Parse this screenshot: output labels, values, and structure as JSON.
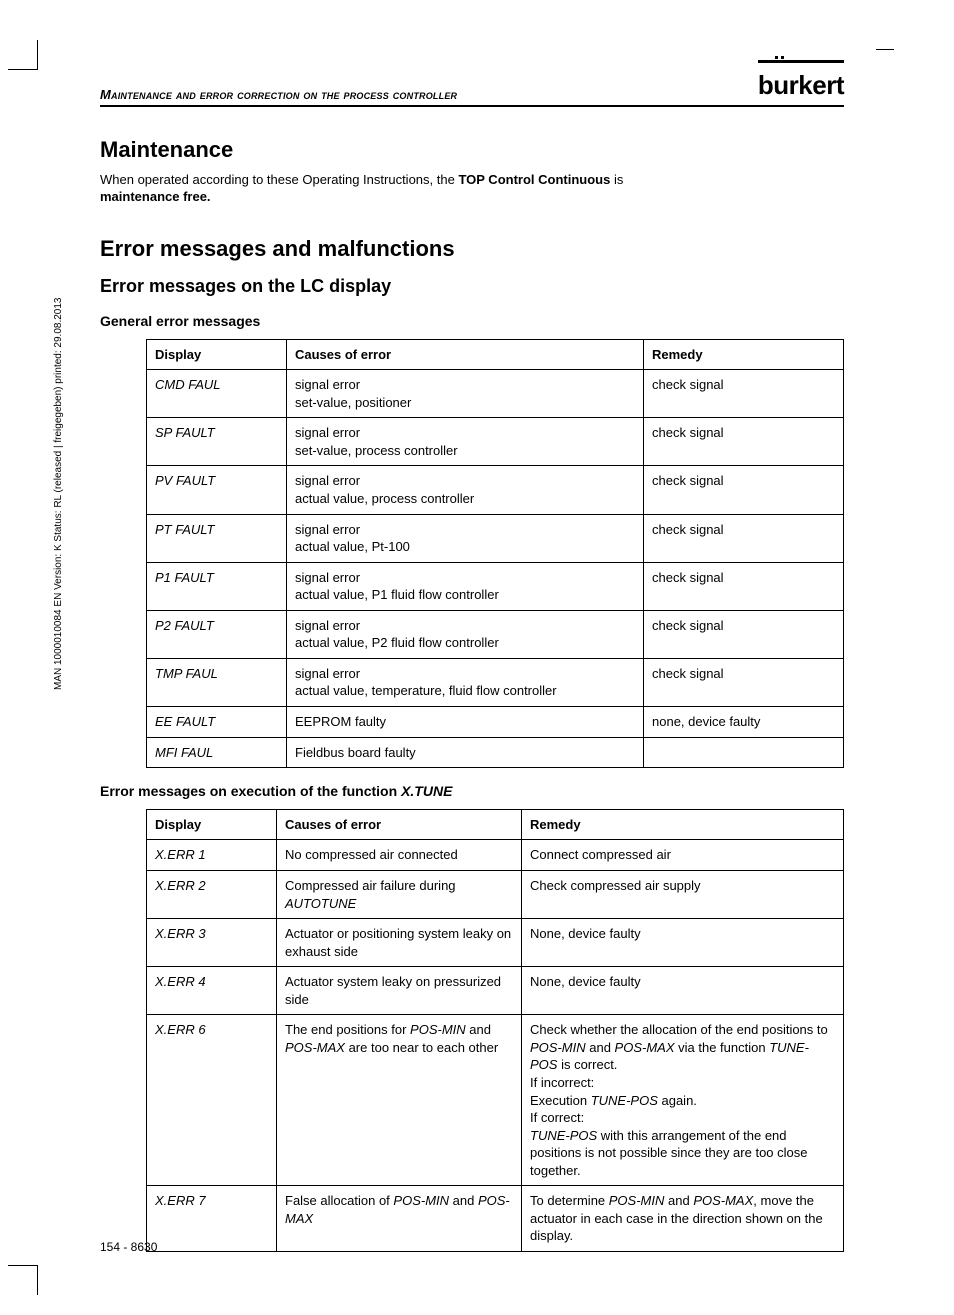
{
  "header": {
    "running": "Maintenance and error correction on the process controller",
    "logo": "burkert"
  },
  "side_text": "MAN 1000010084 EN Version: K Status: RL (released | freigegeben) printed: 29.08.2013",
  "maintenance": {
    "title": "Maintenance",
    "para_a": "When operated according to these Operating Instructions, the ",
    "para_b_bold": "TOP Control Continuous",
    "para_c": " is ",
    "para_d_bold": "maintenance free."
  },
  "errors": {
    "title": "Error messages and malfunctions",
    "sub1": "Error messages on  the LC display",
    "general_title": "General error messages",
    "th_display": "Display",
    "th_cause": "Causes of error",
    "th_remedy": "Remedy",
    "general_rows": [
      {
        "d": "CMD FAUL",
        "c1": "signal error",
        "c2": "set-value, positioner",
        "r": "check signal"
      },
      {
        "d": "SP  FAULT",
        "c1": "signal error",
        "c2": "set-value, process controller",
        "r": "check signal"
      },
      {
        "d": "PV FAULT",
        "c1": "signal error",
        "c2": "actual value, process controller",
        "r": "check signal"
      },
      {
        "d": "PT FAULT",
        "c1": "signal error",
        "c2": "actual value, Pt-100",
        "r": "check signal"
      },
      {
        "d": "P1 FAULT",
        "c1": "signal error",
        "c2": "actual value, P1 fluid flow controller",
        "r": "check signal"
      },
      {
        "d": "P2 FAULT",
        "c1": "signal error",
        "c2": "actual value, P2 fluid flow controller",
        "r": "check signal"
      },
      {
        "d": "TMP FAUL",
        "c1": "signal error",
        "c2": "actual value, temperature, fluid flow controller",
        "r": "check signal"
      },
      {
        "d": "EE FAULT",
        "c1": "EEPROM faulty",
        "c2": "",
        "r": "none, device faulty"
      },
      {
        "d": "MFI FAUL",
        "c1": "Fieldbus board faulty",
        "c2": "",
        "r": ""
      }
    ],
    "xtune_title_a": "Error messages on execution of the function ",
    "xtune_title_b": "X.TUNE",
    "xtune_rows": [
      {
        "d": "X.ERR 1",
        "c": "No compressed air connected",
        "r": "Connect compressed air"
      },
      {
        "d": "X.ERR 2",
        "c_a": "Compressed air failure during ",
        "c_i": "AUTOTUNE",
        "r": "Check compressed air supply"
      },
      {
        "d": "X.ERR 3",
        "c": "Actuator or positioning system leaky on exhaust side",
        "r": "None, device faulty"
      },
      {
        "d": "X.ERR 4",
        "c": "Actuator system leaky on pressurized side",
        "r": "None, device faulty"
      }
    ],
    "xerr6": {
      "d": "X.ERR 6",
      "c_a": "The end positions for ",
      "c_i1": "POS-MIN",
      "c_b": " and ",
      "c_i2": "POS-MAX",
      "c_c": " are too near to each other",
      "r_a": "Check whether the allocation of the end positions to ",
      "r_i1": "POS-MIN",
      "r_b": " and ",
      "r_i2": "POS-MAX",
      "r_c": " via the function ",
      "r_i3": "TUNE-POS",
      "r_d": " is correct.",
      "r_e": "If incorrect:",
      "r_f": "Execution ",
      "r_i4": "TUNE-POS",
      "r_g": " again.",
      "r_h": "If correct:",
      "r_i5": "TUNE-POS",
      "r_i": " with this arrangement of the end positions is not possible since they are too close together."
    },
    "xerr7": {
      "d": "X.ERR 7",
      "c_a": "False allocation of ",
      "c_i1": "POS-MIN",
      "c_b": " and ",
      "c_i2": "POS-MAX",
      "r_a": "To determine ",
      "r_i1": "POS-MIN",
      "r_b": " and ",
      "r_i2": "POS-MAX",
      "r_c": ", move the actuator in each case in the direction shown on the display."
    }
  },
  "footer": "154  -  8630"
}
